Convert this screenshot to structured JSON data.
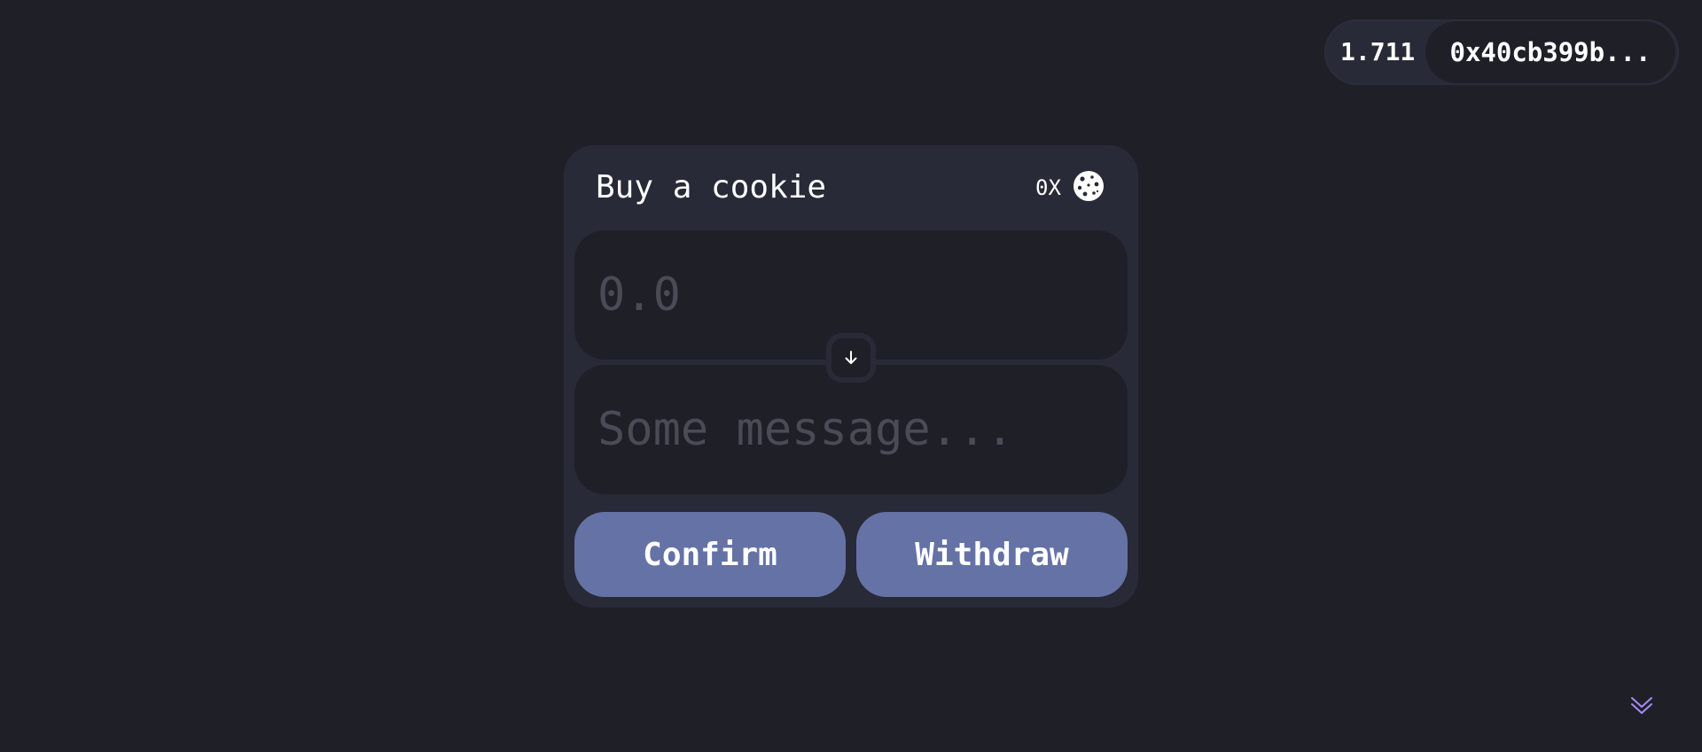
{
  "wallet": {
    "balance": "1.711",
    "address": "0x40cb399b..."
  },
  "card": {
    "title": "Buy a cookie",
    "cookie_count": "0X",
    "cookie_icon": "cookie-icon",
    "amount_placeholder": "0.0",
    "amount_value": "",
    "message_placeholder": "Some message...",
    "message_value": "",
    "swap_icon": "arrow-down-icon",
    "confirm_label": "Confirm",
    "withdraw_label": "Withdraw"
  },
  "footer": {
    "scroll_icon": "double-chevron-down-icon"
  },
  "colors": {
    "background": "#1f1f28",
    "card": "#292a37",
    "button": "#6472a6",
    "placeholder": "#4a4b54",
    "accent_chevron": "#a78bfa"
  }
}
